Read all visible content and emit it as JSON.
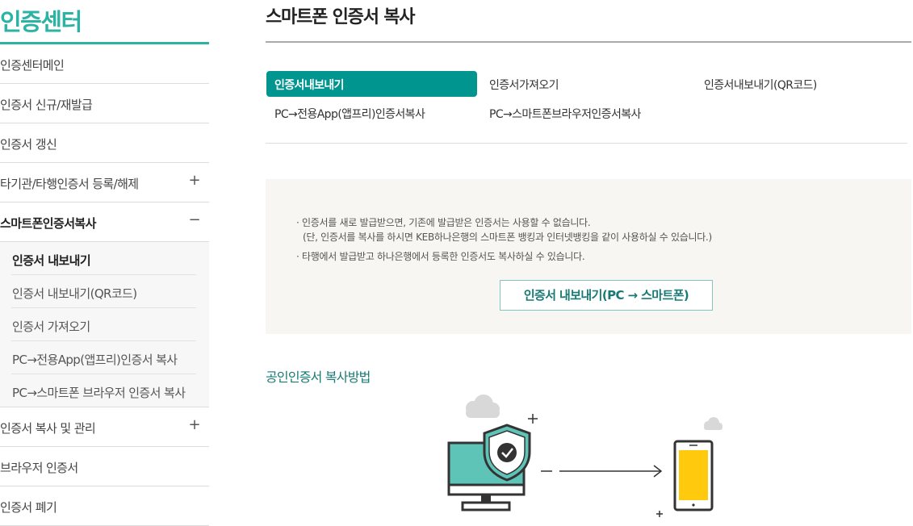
{
  "sidebar": {
    "title": "인증센터",
    "items": [
      {
        "label": "인증센터메인",
        "sign": ""
      },
      {
        "label": "인증서 신규/재발급",
        "sign": ""
      },
      {
        "label": "인증서 갱신",
        "sign": ""
      },
      {
        "label": "타기관/타행인증서 등록/해제",
        "sign": "+"
      },
      {
        "label": "스마트폰인증서복사",
        "sign": "−"
      }
    ],
    "submenu": [
      "인증서 내보내기",
      "인증서 내보내기(QR코드)",
      "인증서 가져오기",
      "PC→전용App(앱프리)인증서 복사",
      "PC→스마트폰 브라우저 인증서 복사"
    ],
    "items_after": [
      {
        "label": "인증서 복사 및 관리",
        "sign": "+"
      },
      {
        "label": "브라우저 인증서",
        "sign": ""
      },
      {
        "label": "인증서 폐기",
        "sign": ""
      }
    ]
  },
  "main": {
    "title": "스마트폰 인증서 복사",
    "tabs": [
      "인증서내보내기",
      "인증서가져오기",
      "인증서내보내기(QR코드)",
      "PC→전용App(앱프리)인증서복사",
      "PC→스마트폰브라우저인증서복사"
    ],
    "notes": [
      "· 인증서를 새로 발급받으면, 기존에 발급받은 인증서는 사용할 수 없습니다.",
      "(단, 인증서를 복사를 하시면 KEB하나은행의 스마트폰 뱅킹과 인터넷뱅킹을 같이 사용하실 수 있습니다.)",
      "· 타행에서 발급받고 하나은행에서 등록한 인증서도 복사하실 수 있습니다."
    ],
    "export_button": "인증서 내보내기(PC → 스마트폰)",
    "section_title": "공인인증서 복사방법"
  },
  "colors": {
    "accent": "#2bb3a3",
    "tab_active": "#00958e",
    "button_text": "#177a74",
    "phone_screen": "#ffc90e",
    "monitor_screen": "#5fc4b8"
  }
}
